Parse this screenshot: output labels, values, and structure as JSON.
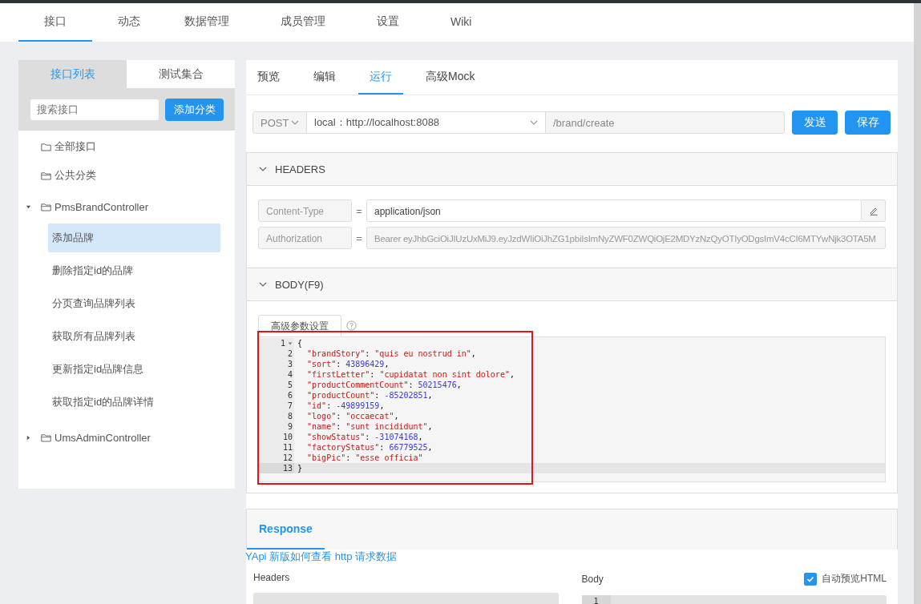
{
  "nav": {
    "tabs": [
      {
        "label": "接口",
        "selected": true
      },
      {
        "label": "动态",
        "selected": false
      },
      {
        "label": "数据管理",
        "selected": false
      },
      {
        "label": "成员管理",
        "selected": false
      },
      {
        "label": "设置",
        "selected": false
      },
      {
        "label": "Wiki",
        "selected": false
      }
    ]
  },
  "sidebar": {
    "tabs": [
      {
        "label": "接口列表",
        "selected": true
      },
      {
        "label": "测试集合",
        "selected": false
      }
    ],
    "search": {
      "placeholder": "搜索接口"
    },
    "add_button": "添加分类",
    "tree": [
      {
        "label": "全部接口",
        "kind": "category"
      },
      {
        "label": "公共分类",
        "kind": "category"
      },
      {
        "label": "PmsBrandController",
        "kind": "controller",
        "expanded": true,
        "children": [
          {
            "label": "添加品牌",
            "selected": true
          },
          {
            "label": "删除指定id的品牌",
            "selected": false
          },
          {
            "label": "分页查询品牌列表",
            "selected": false
          },
          {
            "label": "获取所有品牌列表",
            "selected": false
          },
          {
            "label": "更新指定id品牌信息",
            "selected": false
          },
          {
            "label": "获取指定id的品牌详情",
            "selected": false
          }
        ]
      },
      {
        "label": "UmsAdminController",
        "kind": "controller",
        "expanded": false
      }
    ]
  },
  "main": {
    "tabs": [
      {
        "label": "预览",
        "selected": false
      },
      {
        "label": "编辑",
        "selected": false
      },
      {
        "label": "运行",
        "selected": true
      },
      {
        "label": "高级Mock",
        "selected": false
      }
    ],
    "request": {
      "method": "POST",
      "env": "local：http://localhost:8088",
      "path": "/brand/create",
      "buttons": [
        "发送",
        "保存"
      ]
    },
    "headers": {
      "title": "HEADERS",
      "expanded": true,
      "rows": [
        {
          "name": "Content-Type",
          "separator": "=",
          "value": "application/json",
          "disabled": false
        },
        {
          "name": "Authorization",
          "separator": "=",
          "value": "Bearer eyJhbGciOiJIUzUxMiJ9.eyJzdWIiOiJhZG1pbiIsImNyZWF0ZWQiOjE2MDYzNzQyOTIyODgsImV4cCI6MTYwNjk3OTA5M",
          "disabled": true
        }
      ]
    },
    "body": {
      "title": "BODY(F9)",
      "expanded": true,
      "advanced_button": "高级参数设置",
      "lines": [
        {
          "number": "1",
          "code": "{",
          "active": false
        },
        {
          "number": "2",
          "code": "  \"brandStory\": \"quis eu nostrud in\",",
          "active": false
        },
        {
          "number": "3",
          "code": "  \"sort\": 43896429,",
          "active": false
        },
        {
          "number": "4",
          "code": "  \"firstLetter\": \"cupidatat non sint dolore\",",
          "active": false
        },
        {
          "number": "5",
          "code": "  \"productCommentCount\": 50215476,",
          "active": false
        },
        {
          "number": "6",
          "code": "  \"productCount\": -85202851,",
          "active": false
        },
        {
          "number": "7",
          "code": "  \"id\": -49899159,",
          "active": false
        },
        {
          "number": "8",
          "code": "  \"logo\": \"occaecat\",",
          "active": false
        },
        {
          "number": "9",
          "code": "  \"name\": \"sunt incididunt\",",
          "active": false
        },
        {
          "number": "10",
          "code": "  \"showStatus\": -31074168,",
          "active": false
        },
        {
          "number": "11",
          "code": "  \"factoryStatus\": 66779525,",
          "active": false
        },
        {
          "number": "12",
          "code": "  \"bigPic\": \"esse officia\"",
          "active": false
        },
        {
          "number": "13",
          "code": "}",
          "active": true
        }
      ]
    },
    "response": {
      "tab": "Response",
      "link": "YApi 新版如何查看 http 请求数据",
      "headers_label": "Headers",
      "body_label": "Body",
      "preview": {
        "label": "自动预览HTML",
        "checked": true
      },
      "body_lines": [
        "1"
      ]
    }
  }
}
